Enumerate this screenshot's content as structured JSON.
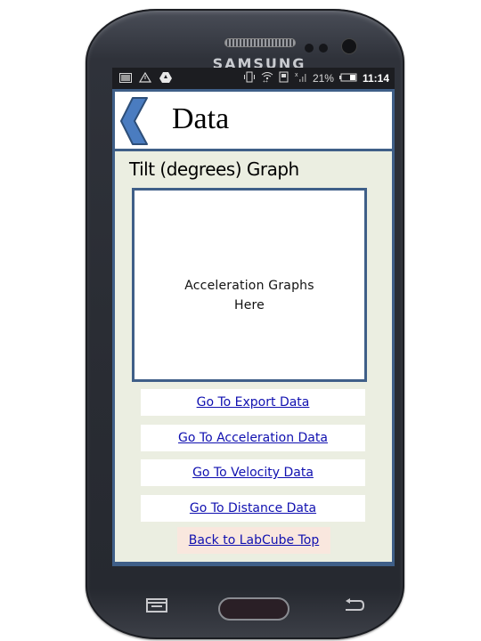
{
  "device": {
    "brand": "SAMSUNG"
  },
  "statusbar": {
    "left_icons": [
      "image-icon",
      "warning-icon",
      "drive-icon"
    ],
    "right_icons": [
      "vibrate-icon",
      "wifi-icon",
      "sim-icon",
      "signal-icon"
    ],
    "battery_percent": "21%",
    "time": "11:14"
  },
  "header": {
    "back_icon": "chevron-left-icon",
    "title": "Data"
  },
  "main": {
    "section_title": "Tilt (degrees) Graph",
    "graph_placeholder_line1": "Acceleration Graphs",
    "graph_placeholder_line2": "Here",
    "links": [
      {
        "label": "Go To Export Data"
      },
      {
        "label": "Go To Acceleration Data"
      },
      {
        "label": "Go To Velocity Data"
      },
      {
        "label": "Go To Distance Data"
      }
    ],
    "back_link": "Back to LabCube Top"
  },
  "colors": {
    "accent": "#3f5f88",
    "content_bg": "#ebeee1",
    "link": "#1010b0",
    "back_link_bg": "#f9e7de",
    "chevron": "#4a7cc0"
  }
}
